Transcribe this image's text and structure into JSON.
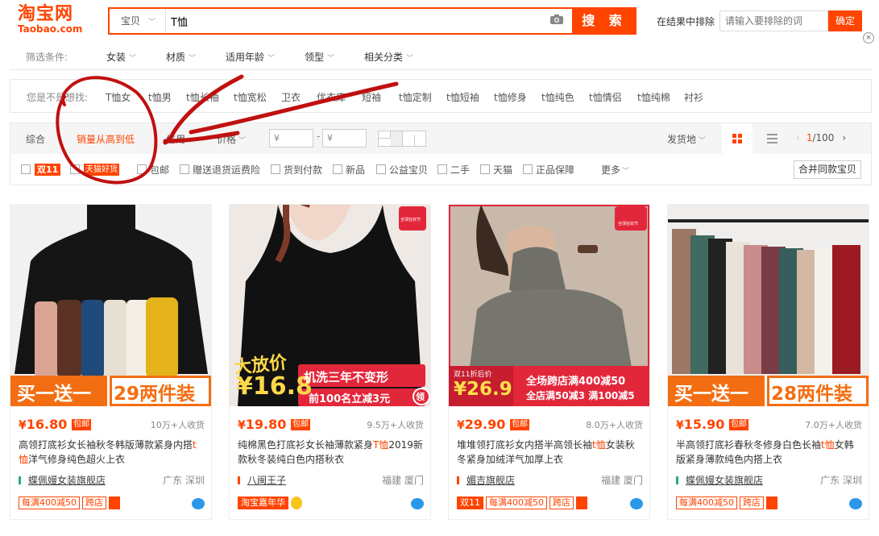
{
  "header": {
    "logo_main": "淘宝网",
    "logo_sub": "Taobao.com",
    "search_scope": "宝贝",
    "search_value": "T恤",
    "search_button": "搜 索",
    "exclude_label": "在结果中排除",
    "exclude_placeholder": "请输入要排除的词",
    "exclude_button": "确定",
    "close_icon": "×"
  },
  "filters": {
    "label": "筛选条件:",
    "items": [
      "女装",
      "材质",
      "适用年龄",
      "领型",
      "相关分类"
    ]
  },
  "suggestions": {
    "label": "您是不是想找:",
    "items": [
      "T恤女",
      "t恤男",
      "t恤长袖",
      "t恤宽松",
      "卫衣",
      "优衣库",
      "短袖",
      "t恤定制",
      "t恤短袖",
      "t恤修身",
      "t恤纯色",
      "t恤情侣",
      "t恤纯棉",
      "衬衫"
    ]
  },
  "sort": {
    "items": [
      "综合",
      "销量从高到低",
      "信用",
      "价格"
    ],
    "active": "销量从高到低",
    "price_from": "¥",
    "price_to": "¥",
    "price_sep": "-",
    "ship_from": "发货地",
    "page": "1",
    "total": "/100"
  },
  "options": {
    "items": [
      "双11",
      "天猫好货",
      "包邮",
      "赠送退货运费险",
      "货到付款",
      "新品",
      "公益宝贝",
      "二手",
      "天猫",
      "正品保障"
    ],
    "more": "更多",
    "merge": "合并同款宝贝"
  },
  "products": [
    {
      "price": "16.80",
      "post": "包邮",
      "sales": "10万+人收货",
      "title_pre": "高领打底衫女长袖秋冬韩版薄款紧身内搭",
      "title_hl": "t恤",
      "title_post": "洋气修身纯色超火上衣",
      "shop": "蝶佩嫚女装旗舰店",
      "location": "广东 深圳",
      "tags": [
        "每满400减50",
        "跨店"
      ],
      "banner_left": "买一送一",
      "banner_right": "29两件装"
    },
    {
      "price": "19.80",
      "post": "包邮",
      "sales": "9.5万+人收货",
      "title_pre": "纯棉黑色打底衫女长袖薄款紧身",
      "title_hl": "T恤",
      "title_post": "2019新款秋冬装纯白色内搭秋衣",
      "shop": "八闽王子",
      "location": "福建 厦门",
      "tags": [
        "淘宝嘉年华"
      ],
      "badge_text": "全球狂欢节",
      "promo_big": "大放价",
      "promo_price": "¥16.8",
      "promo_line1": "机洗三年不变形",
      "promo_line2": "前100名立减3元",
      "promo_claim": "领"
    },
    {
      "price": "29.90",
      "post": "包邮",
      "sales": "8.0万+人收货",
      "title_pre": "堆堆领打底衫女内搭半高领长袖",
      "title_hl": "t恤",
      "title_post": "女装秋冬紧身加绒洋气加厚上衣",
      "shop": "媚吉旗舰店",
      "location": "福建 厦门",
      "tags": [
        "双11",
        "每满400减50",
        "跨店"
      ],
      "badge_text": "全球狂欢节",
      "promo_small": "双11折后价",
      "promo_price": "¥26.9",
      "promo_line1": "全场跨店满400减50",
      "promo_line2": "全店满50减3 满100减5"
    },
    {
      "price": "15.90",
      "post": "包邮",
      "sales": "7.0万+人收货",
      "title_pre": "半高领打底衫春秋冬修身白色长袖",
      "title_hl": "t恤",
      "title_post": "女韩版紧身薄款纯色内搭上衣",
      "shop": "蝶佩嫚女装旗舰店",
      "location": "广东 深圳",
      "tags": [
        "每满400减50",
        "跨店"
      ],
      "banner_left": "买一送一",
      "banner_right": "28两件装"
    }
  ],
  "colors": {
    "accent": "#ff4400",
    "annotation": "#c01010"
  }
}
